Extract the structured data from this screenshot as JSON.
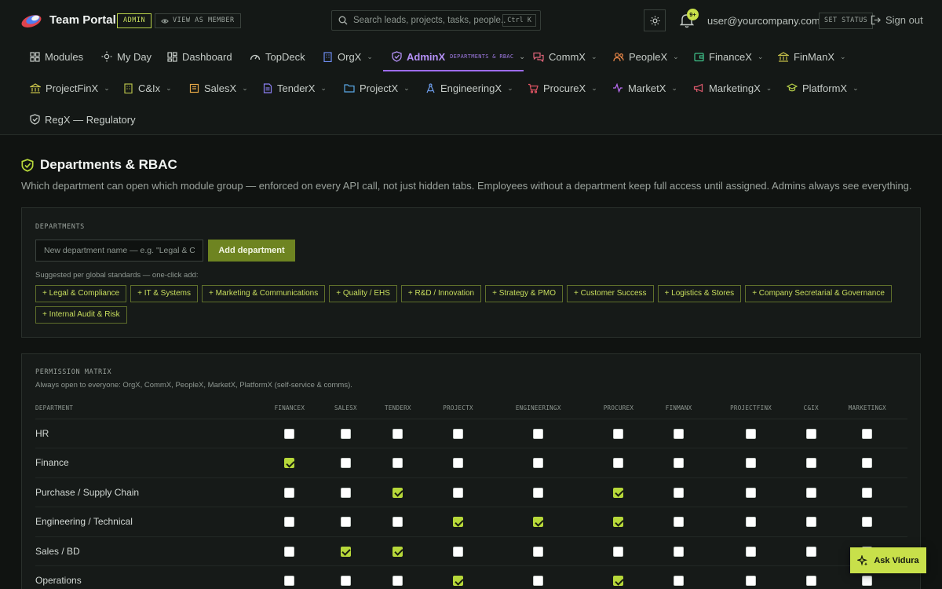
{
  "app": {
    "title": "Team Portal",
    "role_badge": "ADMIN",
    "view_as_member": "VIEW AS MEMBER",
    "search_placeholder": "Search leads, projects, tasks, people...",
    "search_shortcut": "Ctrl K",
    "notification_count": "9+",
    "user_email": "user@yourcompany.com",
    "set_status": "SET STATUS",
    "sign_out": "Sign out"
  },
  "nav": {
    "modules": "Modules",
    "my_day": "My Day",
    "dashboard": "Dashboard",
    "topdeck": "TopDeck",
    "orgx": "OrgX",
    "adminx": "AdminX",
    "adminx_tag": "DEPARTMENTS & RBAC",
    "commx": "CommX",
    "peoplex": "PeopleX",
    "financex": "FinanceX",
    "finmanx": "FinManX",
    "projectfinx": "ProjectFinX",
    "cix": "C&Ix",
    "salesx": "SalesX",
    "tenderx": "TenderX",
    "projectx": "ProjectX",
    "engineeringx": "EngineeringX",
    "procurex": "ProcureX",
    "marketx": "MarketX",
    "marketingx": "MarketingX",
    "platformx": "PlatformX",
    "regx": "RegX — Regulatory"
  },
  "page": {
    "title": "Departments & RBAC",
    "description": "Which department can open which module group — enforced on every API call, not just hidden tabs. Employees without a department keep full access until assigned. Admins always see everything."
  },
  "departments": {
    "label": "DEPARTMENTS",
    "input_placeholder": "New department name — e.g. \"Legal & Compliance\"",
    "add_button": "Add department",
    "suggest_label": "Suggested per global standards — one-click add:",
    "suggestions": [
      "+ Legal & Compliance",
      "+ IT & Systems",
      "+ Marketing & Communications",
      "+ Quality / EHS",
      "+ R&D / Innovation",
      "+ Strategy & PMO",
      "+ Customer Success",
      "+ Logistics & Stores",
      "+ Company Secretarial & Governance",
      "+ Internal Audit & Risk"
    ]
  },
  "matrix": {
    "label": "PERMISSION MATRIX",
    "subtitle": "Always open to everyone: OrgX, CommX, PeopleX, MarketX, PlatformX (self-service & comms).",
    "dept_header": "DEPARTMENT",
    "columns": [
      "FINANCEX",
      "SALESX",
      "TENDERX",
      "PROJECTX",
      "ENGINEERINGX",
      "PROCUREX",
      "FINMANX",
      "PROJECTFINX",
      "C&IX",
      "MARKETINGX"
    ],
    "rows": [
      {
        "name": "HR",
        "perms": [
          false,
          false,
          false,
          false,
          false,
          false,
          false,
          false,
          false,
          false
        ]
      },
      {
        "name": "Finance",
        "perms": [
          true,
          false,
          false,
          false,
          false,
          false,
          false,
          false,
          false,
          false
        ]
      },
      {
        "name": "Purchase / Supply Chain",
        "perms": [
          false,
          false,
          true,
          false,
          false,
          true,
          false,
          false,
          false,
          false
        ]
      },
      {
        "name": "Engineering / Technical",
        "perms": [
          false,
          false,
          false,
          true,
          true,
          true,
          false,
          false,
          false,
          false
        ]
      },
      {
        "name": "Sales / BD",
        "perms": [
          false,
          true,
          true,
          false,
          false,
          false,
          false,
          false,
          false,
          false
        ]
      },
      {
        "name": "Operations",
        "perms": [
          false,
          false,
          false,
          true,
          false,
          true,
          false,
          false,
          false,
          false
        ]
      }
    ]
  },
  "assistant": {
    "label": "Ask Vidura"
  }
}
